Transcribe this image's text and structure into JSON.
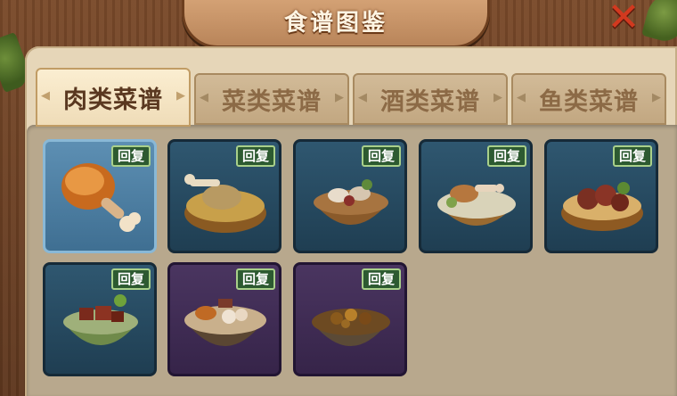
{
  "window": {
    "title": "食谱图鉴"
  },
  "tabs": [
    {
      "label": "肉类菜谱",
      "active": true
    },
    {
      "label": "菜类菜谱",
      "active": false
    },
    {
      "label": "酒类菜谱",
      "active": false
    },
    {
      "label": "鱼类菜谱",
      "active": false
    }
  ],
  "recipes": [
    {
      "badge": "回复",
      "icon": "roast-drumstick-icon",
      "frame": "selected"
    },
    {
      "badge": "回复",
      "icon": "bone-broth-bowl-icon",
      "frame": "blue"
    },
    {
      "badge": "回复",
      "icon": "mushroom-stew-bowl-icon",
      "frame": "blue"
    },
    {
      "badge": "回复",
      "icon": "drumstick-soup-bowl-icon",
      "frame": "blue"
    },
    {
      "badge": "回复",
      "icon": "sliced-meat-bowl-icon",
      "frame": "blue"
    },
    {
      "badge": "回复",
      "icon": "braised-pork-bowl-icon",
      "frame": "blue"
    },
    {
      "badge": "回复",
      "icon": "meatball-hotpot-icon",
      "frame": "purple"
    },
    {
      "badge": "回复",
      "icon": "beef-stew-bowl-icon",
      "frame": "purple"
    }
  ],
  "colors": {
    "badge": "#2d5a31",
    "close": "#d2391f",
    "selected_card": "#5d8fb3"
  }
}
